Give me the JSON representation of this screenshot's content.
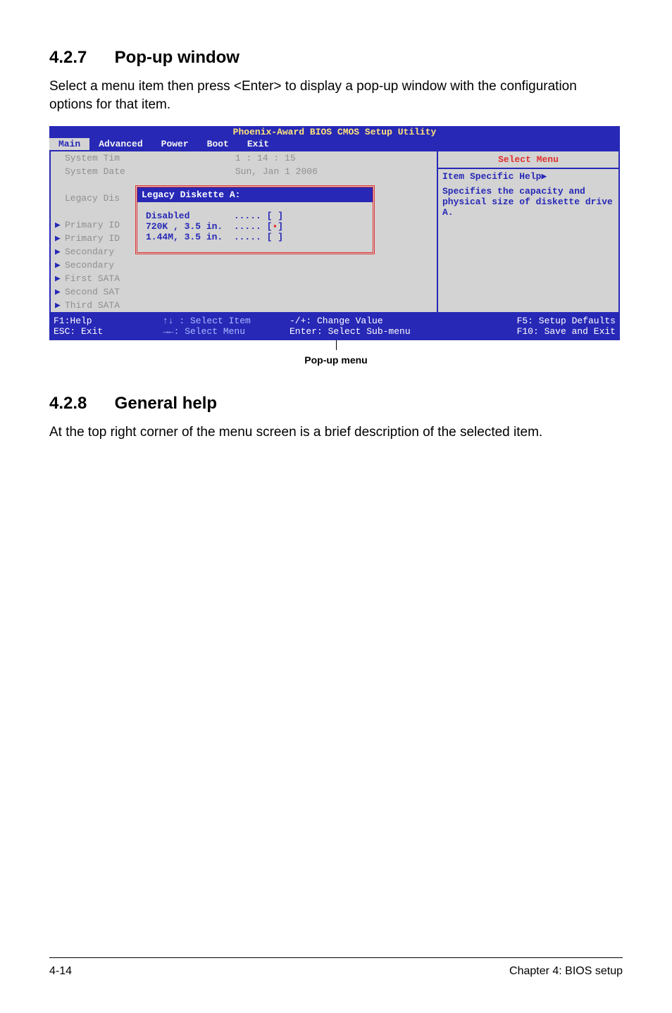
{
  "section1": {
    "number": "4.2.7",
    "title": "Pop-up window",
    "body": "Select a menu item then press <Enter> to display a pop-up window with the configuration options for that item."
  },
  "bios": {
    "title": "Phoenix-Award BIOS CMOS Setup Utility",
    "tabs": [
      "Main",
      "Advanced",
      "Power",
      "Boot",
      "Exit"
    ],
    "active_tab": 0,
    "left": {
      "rows": [
        {
          "label": "System Tim",
          "value": "1 : 14 : 15",
          "arrow": false
        },
        {
          "label": "System Date",
          "value": "Sun, Jan 1 2006",
          "arrow": false
        },
        {
          "label": "",
          "value": "",
          "arrow": false
        },
        {
          "label": "Legacy Dis",
          "value": "",
          "arrow": false
        },
        {
          "label": "",
          "value": "",
          "arrow": false
        },
        {
          "label": "Primary ID",
          "value": "",
          "arrow": true
        },
        {
          "label": "Primary ID",
          "value": "",
          "arrow": true
        },
        {
          "label": "Secondary",
          "value": "",
          "arrow": true
        },
        {
          "label": "Secondary",
          "value": "",
          "arrow": true
        },
        {
          "label": "First SATA",
          "value": "",
          "arrow": true
        },
        {
          "label": "Second SAT",
          "value": "",
          "arrow": true
        },
        {
          "label": "Third SATA",
          "value": "",
          "arrow": true
        }
      ]
    },
    "popup": {
      "header": "Legacy Diskette A:",
      "options": [
        {
          "label": "Disabled",
          "mark": " "
        },
        {
          "label": "720K , 3.5 in.",
          "mark": "▪"
        },
        {
          "label": "1.44M, 3.5 in.",
          "mark": " "
        }
      ]
    },
    "right": {
      "select_menu": "Select Menu",
      "help_title": "Item Specific Help",
      "help_text": "Specifies the capacity and physical size of diskette drive A."
    },
    "footer": {
      "f1": "F1:Help",
      "esc": "ESC: Exit",
      "sel_item": "↑↓ : Select Item",
      "sel_menu": "→←: Select Menu",
      "change": "-/+: Change Value",
      "enter": "Enter: Select Sub-menu",
      "f5": "F5: Setup Defaults",
      "f10": "F10: Save and Exit"
    },
    "caption": "Pop-up menu"
  },
  "section2": {
    "number": "4.2.8",
    "title": "General help",
    "body": "At the top right corner of the menu screen is a brief description of the selected item."
  },
  "page_footer": {
    "left": "4-14",
    "right": "Chapter 4: BIOS setup"
  }
}
